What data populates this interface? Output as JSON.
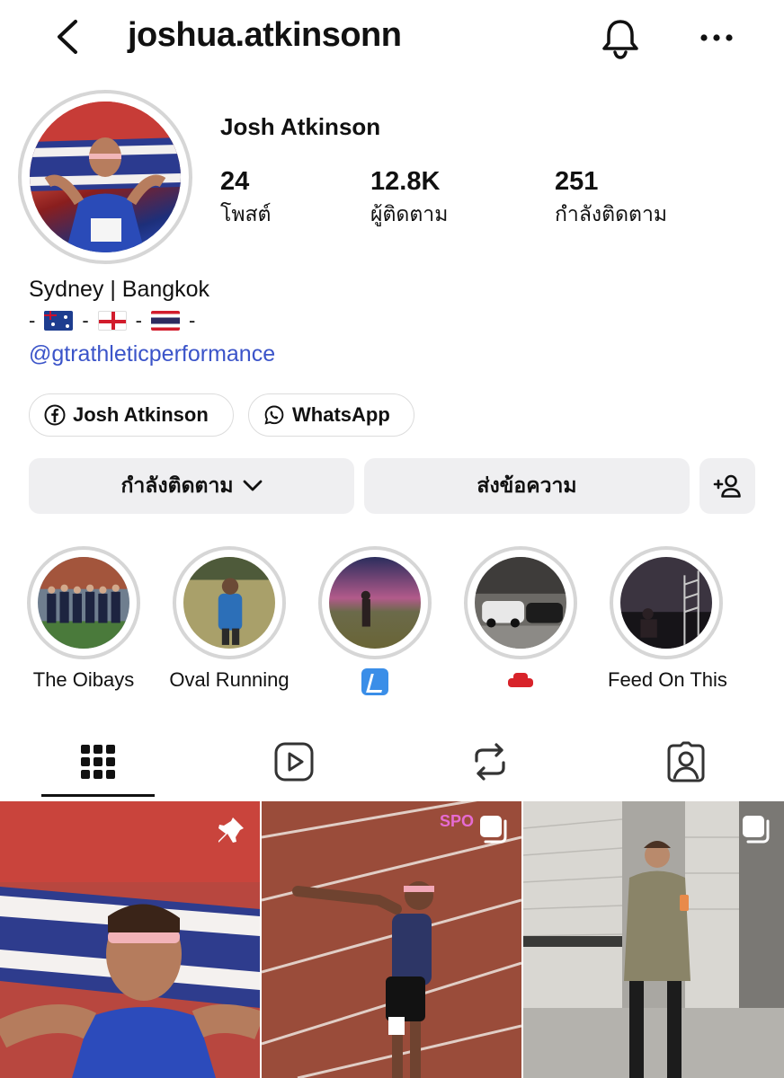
{
  "header": {
    "username": "joshua.atkinsonn"
  },
  "profile": {
    "display_name": "Josh Atkinson",
    "stats": {
      "posts_count": "24",
      "posts_label": "โพสต์",
      "followers_count": "12.8K",
      "followers_label": "ผู้ติดตาม",
      "following_count": "251",
      "following_label": "กำลังติดตาม"
    },
    "bio": {
      "location": "Sydney | Bangkok",
      "flags_line": [
        "-",
        "-",
        "-",
        "-"
      ],
      "link": "@gtrathleticperformance"
    },
    "links": {
      "facebook": "Josh Atkinson",
      "whatsapp": "WhatsApp"
    },
    "actions": {
      "following": "กำลังติดตาม",
      "message": "ส่งข้อความ"
    }
  },
  "highlights": [
    {
      "label": "The Oibays"
    },
    {
      "label": "Oval Running"
    },
    {
      "label": ""
    },
    {
      "label": ""
    },
    {
      "label": "Feed On This"
    }
  ],
  "tabs": [
    "grid-icon",
    "reels-icon",
    "reposts-icon",
    "tagged-icon"
  ],
  "posts": [
    {
      "icon": "pin-icon"
    },
    {
      "overlay_text": "SPO",
      "icon": "carousel-icon"
    },
    {
      "icon": "carousel-icon"
    }
  ],
  "colors": {
    "link": "#3b54c9",
    "button_bg": "#efeff1",
    "ring": "#d6d6d6"
  }
}
